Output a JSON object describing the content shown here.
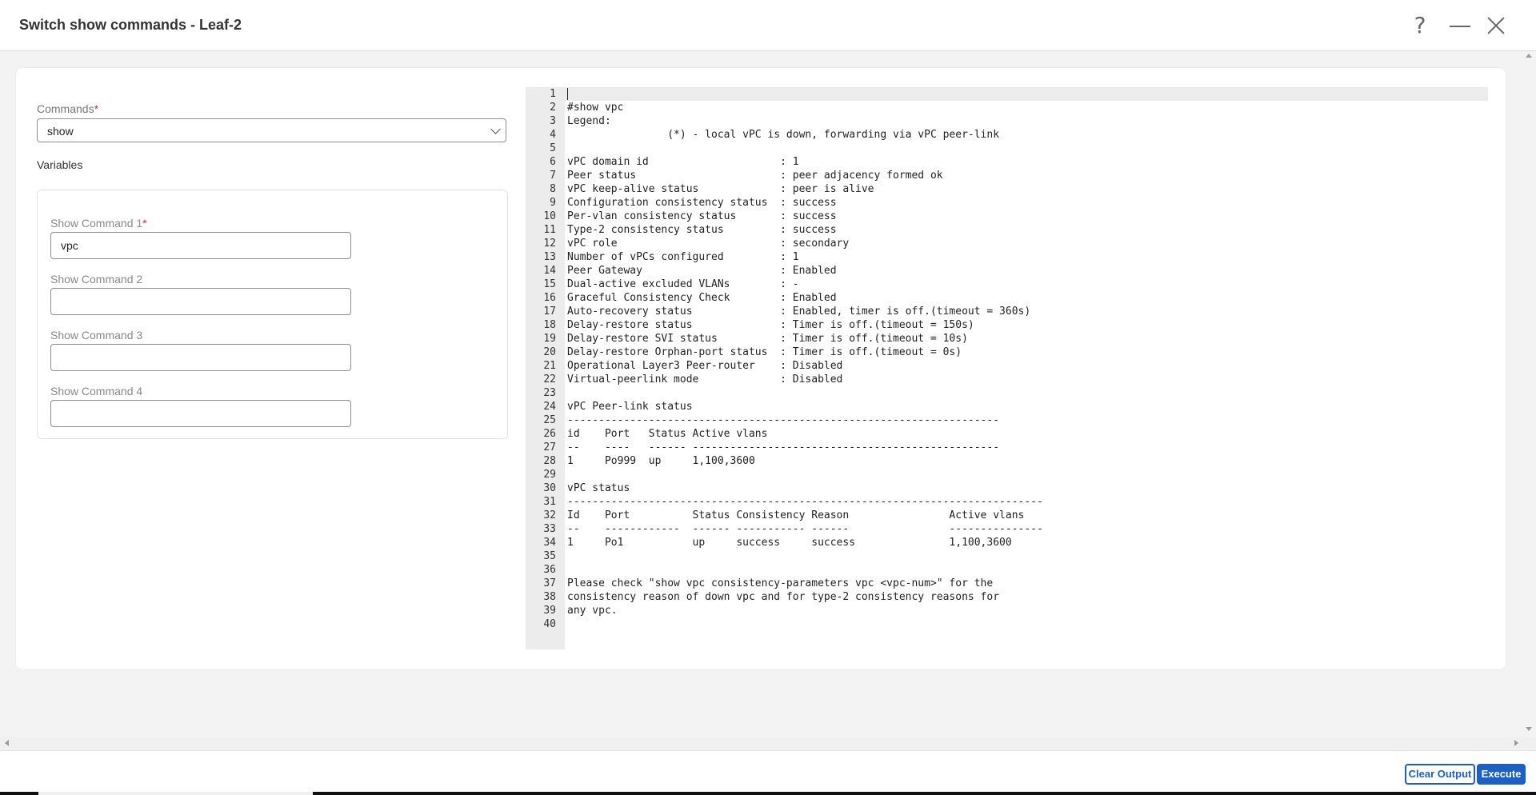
{
  "window": {
    "title": "Switch show commands - Leaf-2",
    "help_glyph": "?"
  },
  "form": {
    "commands_label": "Commands",
    "required_mark": "*",
    "commands_value": "show",
    "variables_label": "Variables",
    "show_commands": [
      {
        "label": "Show Command 1",
        "required": true,
        "value": "vpc"
      },
      {
        "label": "Show Command 2",
        "required": false,
        "value": ""
      },
      {
        "label": "Show Command 3",
        "required": false,
        "value": ""
      },
      {
        "label": "Show Command 4",
        "required": false,
        "value": ""
      }
    ]
  },
  "output": {
    "lines": [
      "",
      "#show vpc",
      "Legend:",
      "                (*) - local vPC is down, forwarding via vPC peer-link",
      "",
      "vPC domain id                     : 1",
      "Peer status                       : peer adjacency formed ok",
      "vPC keep-alive status             : peer is alive",
      "Configuration consistency status  : success",
      "Per-vlan consistency status       : success",
      "Type-2 consistency status         : success",
      "vPC role                          : secondary",
      "Number of vPCs configured         : 1",
      "Peer Gateway                      : Enabled",
      "Dual-active excluded VLANs        : -",
      "Graceful Consistency Check        : Enabled",
      "Auto-recovery status              : Enabled, timer is off.(timeout = 360s)",
      "Delay-restore status              : Timer is off.(timeout = 150s)",
      "Delay-restore SVI status          : Timer is off.(timeout = 10s)",
      "Delay-restore Orphan-port status  : Timer is off.(timeout = 0s)",
      "Operational Layer3 Peer-router    : Disabled",
      "Virtual-peerlink mode             : Disabled",
      "",
      "vPC Peer-link status",
      "---------------------------------------------------------------------",
      "id    Port   Status Active vlans",
      "--    ----   ------ -------------------------------------------------",
      "1     Po999  up     1,100,3600",
      "",
      "vPC status",
      "----------------------------------------------------------------------------",
      "Id    Port          Status Consistency Reason                Active vlans",
      "--    ------------  ------ ----------- ------                ---------------",
      "1     Po1           up     success     success               1,100,3600",
      "",
      "",
      "Please check \"show vpc consistency-parameters vpc <vpc-num>\" for the",
      "consistency reason of down vpc and for type-2 consistency reasons for",
      "any vpc.",
      ""
    ]
  },
  "footer": {
    "clear_label": "Clear Output",
    "execute_label": "Execute"
  }
}
